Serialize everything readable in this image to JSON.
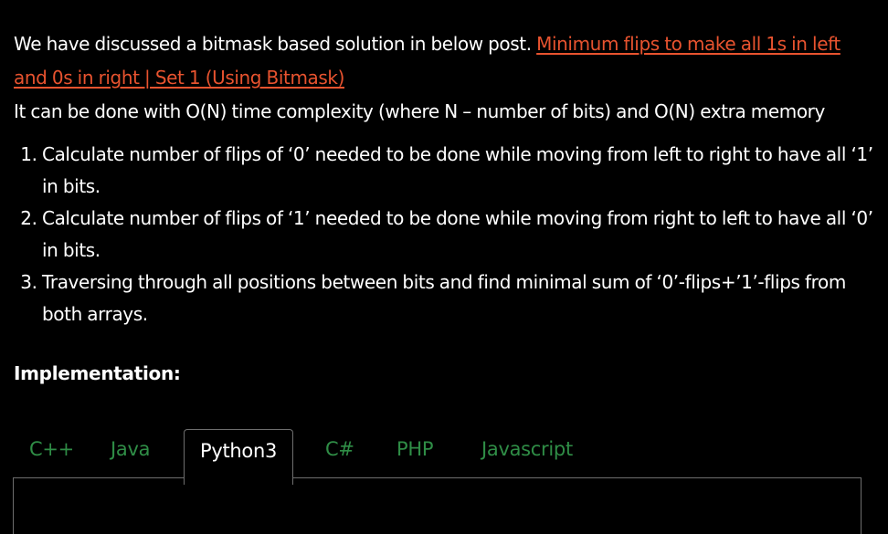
{
  "intro": {
    "text_before_link": "We have discussed a bitmask based solution in below post. ",
    "link_text": "Minimum flips to make all 1s in left and 0s in right | Set 1 (Using Bitmask)",
    "complexity_text": "It can be done with O(N) time complexity (where N – number of bits) and O(N) extra memory"
  },
  "steps": [
    "Calculate number of flips of ‘0’ needed to be done while moving from left to right to have all ‘1’ in bits.",
    "Calculate number of flips of ‘1’ needed to be done while moving from right to left to have all ‘0’ in bits.",
    "Traversing through all positions between bits and find minimal sum of ‘0’-flips+’1’-flips from both arrays."
  ],
  "heading": "Implementation:",
  "tabs": {
    "items": [
      "C++",
      "Java",
      "Python3",
      "C#",
      "PHP",
      "Javascript"
    ],
    "active": "Python3"
  },
  "colors": {
    "background": "#000000",
    "text": "#ffffff",
    "link": "#e8532f",
    "tab_inactive": "#2f8d46",
    "tab_border": "#6e6e6e"
  }
}
